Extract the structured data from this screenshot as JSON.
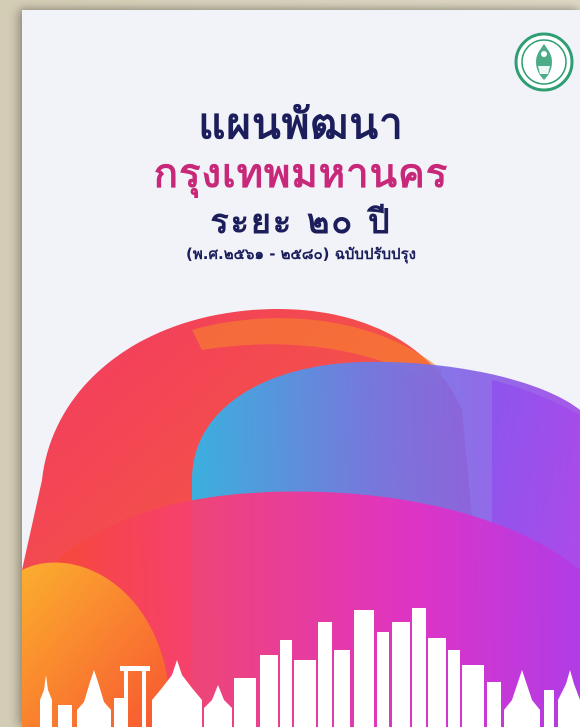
{
  "cover": {
    "title_line1": "แผนพัฒนา",
    "title_line2": "กรุงเทพมหานคร",
    "title_line3": "ระยะ ๒๐ ปี",
    "subtitle": "(พ.ศ.๒๕๖๑ - ๒๕๘๐) ฉบับปรับปรุง"
  },
  "colors": {
    "title_navy": "#1c1e5c",
    "title_magenta": "#c8287a",
    "seal_green": "#2e9e73",
    "page_background": "#f2f3f8"
  },
  "icons": {
    "seal": "bangkok-metropolitan-seal-icon",
    "skyline": "bangkok-skyline-silhouette"
  }
}
